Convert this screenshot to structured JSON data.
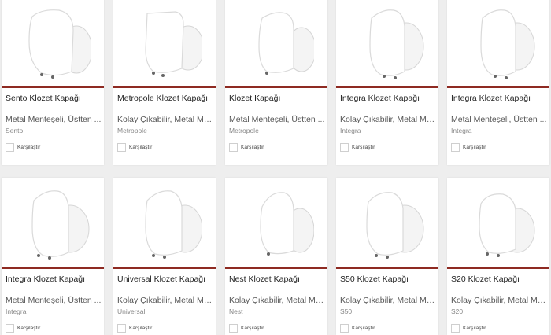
{
  "compare_label": "Karşılaştır",
  "products": [
    {
      "title": "Sento Klozet Kapağı",
      "desc": "Metal Menteşeli, Üstten ...",
      "brand": "Sento",
      "icon": "toilet-seat-icon"
    },
    {
      "title": "Metropole Klozet Kapağı",
      "desc": "Kolay Çıkabilir, Metal Me...",
      "brand": "Metropole",
      "icon": "toilet-seat-icon"
    },
    {
      "title": "Klozet Kapağı",
      "desc": "Metal Menteşeli, Üstten ...",
      "brand": "Metropole",
      "icon": "toilet-seat-icon"
    },
    {
      "title": "Integra Klozet Kapağı",
      "desc": "Kolay Çıkabilir, Metal Me...",
      "brand": "Integra",
      "icon": "toilet-seat-icon"
    },
    {
      "title": "Integra Klozet Kapağı",
      "desc": "Metal Menteşeli, Üstten ...",
      "brand": "Integra",
      "icon": "toilet-seat-icon"
    },
    {
      "title": "Integra Klozet Kapağı",
      "desc": "Metal Menteşeli, Üstten ...",
      "brand": "Integra",
      "icon": "toilet-seat-icon"
    },
    {
      "title": "Universal Klozet Kapağı",
      "desc": "Kolay Çıkabilir, Metal Me...",
      "brand": "Universal",
      "icon": "toilet-seat-icon"
    },
    {
      "title": "Nest Klozet Kapağı",
      "desc": "Kolay Çıkabilir, Metal Me...",
      "brand": "Nest",
      "icon": "toilet-seat-icon"
    },
    {
      "title": "S50 Klozet Kapağı",
      "desc": "Kolay Çıkabilir, Metal Me...",
      "brand": "S50",
      "icon": "toilet-seat-icon"
    },
    {
      "title": "S20 Klozet Kapağı",
      "desc": "Kolay Çıkabilir, Metal Me...",
      "brand": "S20",
      "icon": "toilet-seat-icon"
    }
  ],
  "colors": {
    "accent_bar": "#8e2a22",
    "background": "#eeeeee",
    "card": "#ffffff"
  }
}
